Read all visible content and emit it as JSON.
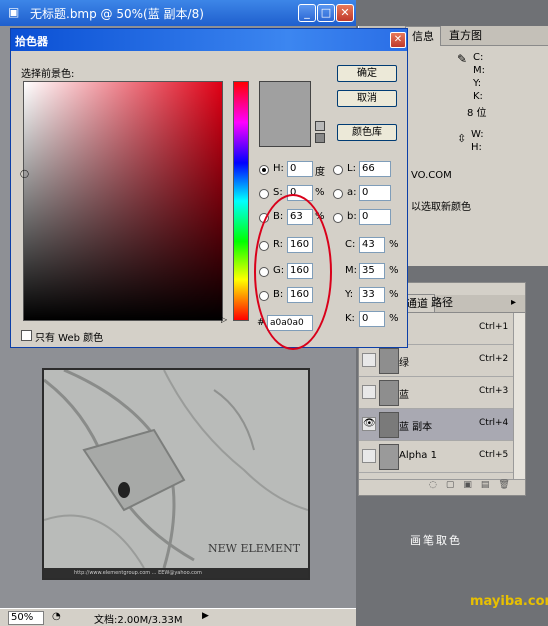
{
  "document": {
    "title": "无标题.bmp @ 50%(蓝 副本/8)",
    "watermark": "NEW ELEMENT",
    "footer_strip": "http://www.elementgroup.com  ...  EEW@yahoo.com",
    "zoom": "50%",
    "doc_info": "文档:2.00M/3.33M"
  },
  "info_panel": {
    "tabs": [
      "信息",
      "直方图"
    ],
    "cmyk_labels": [
      "C:",
      "M:",
      "Y:",
      "K:",
      "8 位"
    ],
    "wh_labels": [
      "W:",
      "H:"
    ],
    "line1": "VO.COM",
    "line2": "以选取新颜色"
  },
  "layers_panel": {
    "tabs": [
      "通道",
      "路径"
    ],
    "layers": [
      {
        "name": "",
        "shortcut": "Ctrl+1",
        "visible": false
      },
      {
        "name": "绿",
        "shortcut": "Ctrl+2",
        "visible": false
      },
      {
        "name": "蓝",
        "shortcut": "Ctrl+3",
        "visible": false
      },
      {
        "name": "蓝 副本",
        "shortcut": "Ctrl+4",
        "visible": true
      },
      {
        "name": "Alpha 1",
        "shortcut": "Ctrl+5",
        "visible": false
      }
    ]
  },
  "color_picker": {
    "title": "拾色器",
    "subtitle": "选择前景色:",
    "buttons": {
      "ok": "确定",
      "cancel": "取消",
      "libraries": "颜色库"
    },
    "web_only": "只有 Web 颜色",
    "fields": {
      "H": {
        "label": "H:",
        "value": "0",
        "unit": "度"
      },
      "S": {
        "label": "S:",
        "value": "0",
        "unit": "%"
      },
      "B": {
        "label": "B:",
        "value": "63",
        "unit": "%"
      },
      "R": {
        "label": "R:",
        "value": "160"
      },
      "G": {
        "label": "G:",
        "value": "160"
      },
      "Bl": {
        "label": "B:",
        "value": "160"
      },
      "L": {
        "label": "L:",
        "value": "66"
      },
      "a": {
        "label": "a:",
        "value": "0"
      },
      "b": {
        "label": "b:",
        "value": "0"
      },
      "C": {
        "label": "C:",
        "value": "43",
        "unit": "%"
      },
      "M": {
        "label": "M:",
        "value": "35",
        "unit": "%"
      },
      "Y": {
        "label": "Y:",
        "value": "33",
        "unit": "%"
      },
      "K": {
        "label": "K:",
        "value": "0",
        "unit": "%"
      }
    },
    "hex": "a0a0a0",
    "hex_label": "#",
    "current_color": "#a0a0a0"
  },
  "caption": "画笔取色",
  "site": "mayiba.com"
}
